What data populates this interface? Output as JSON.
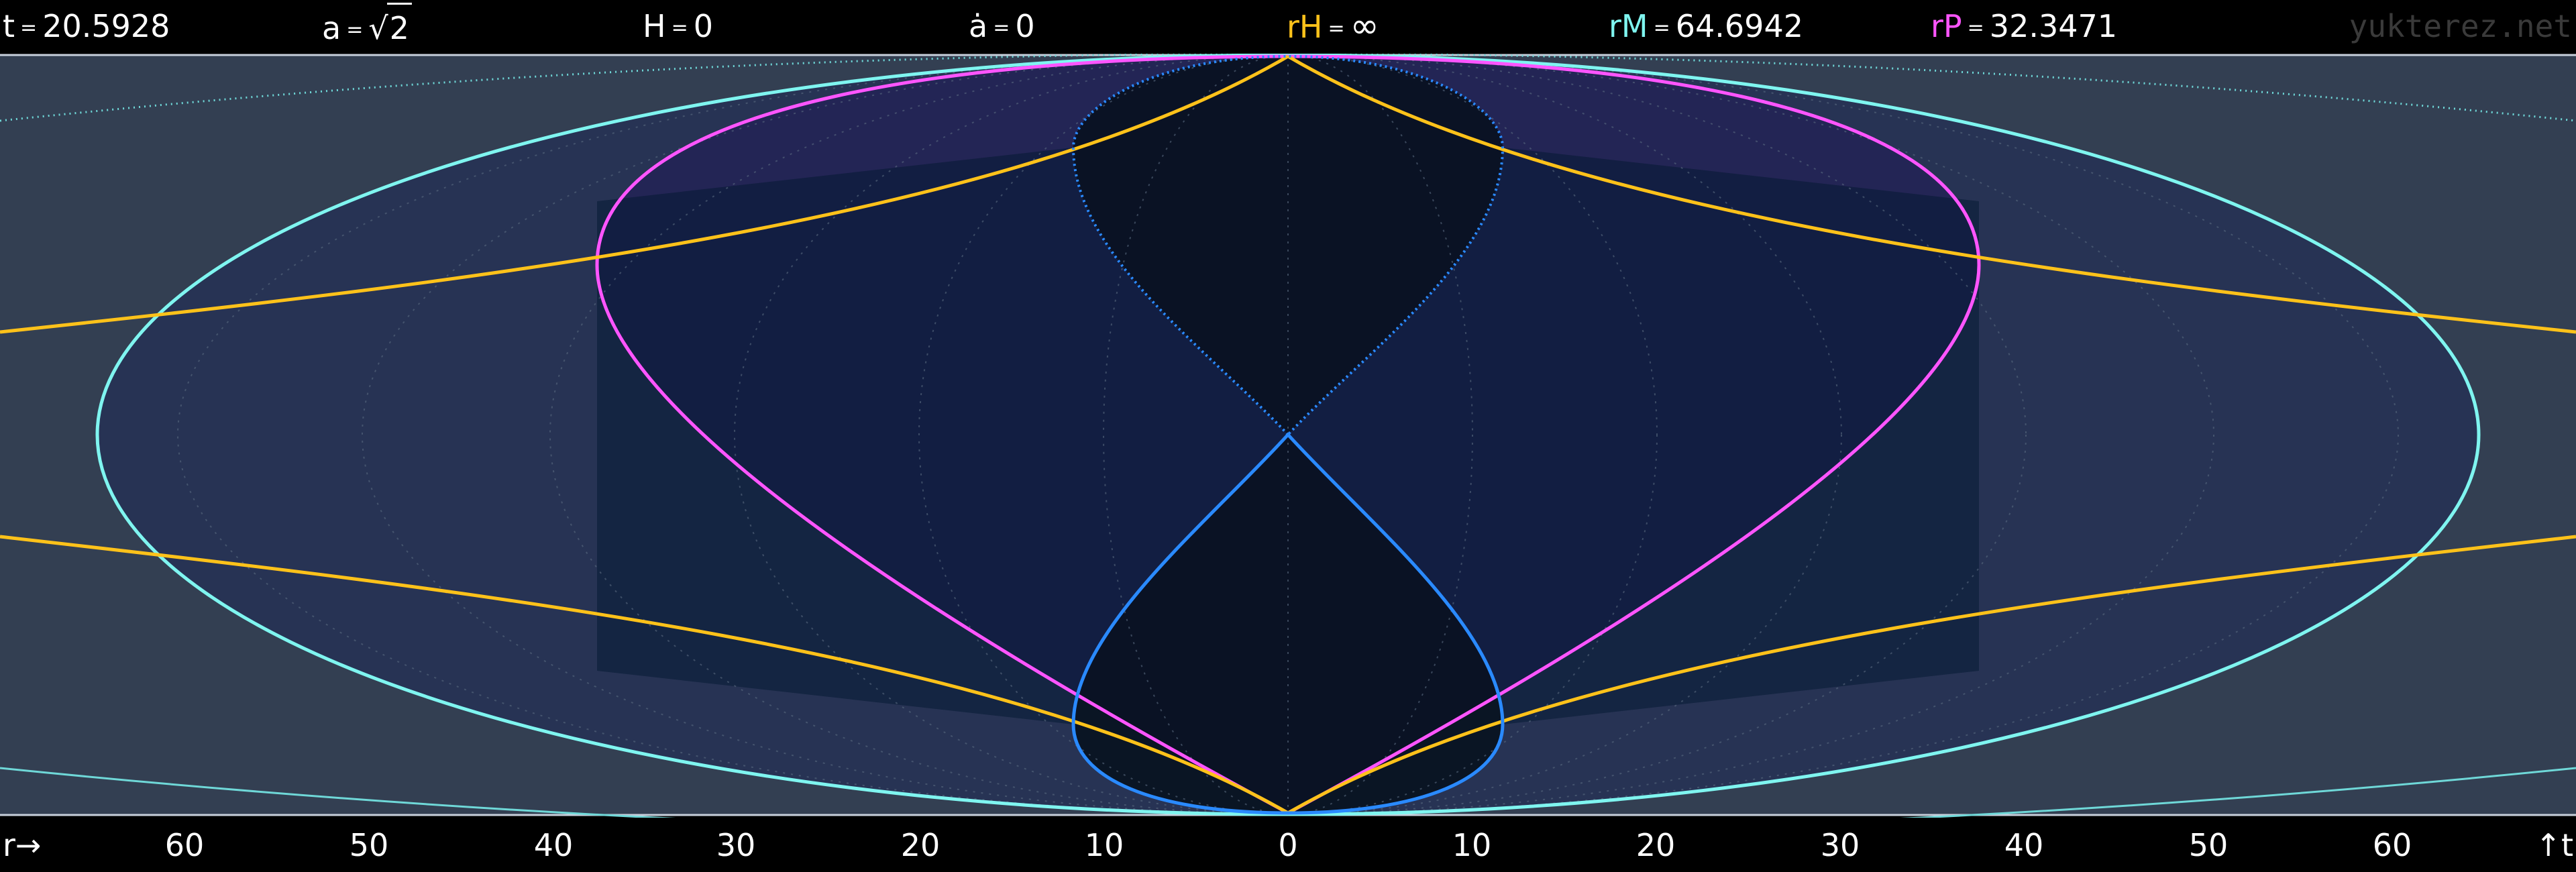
{
  "header": {
    "t": {
      "symbol": "t",
      "eq": "=",
      "value": "20.5928",
      "color": "#ffffff"
    },
    "a": {
      "symbol": "a",
      "eq": "=",
      "radical": "√",
      "radicand": "2",
      "color": "#ffffff"
    },
    "H": {
      "symbol": "H",
      "eq": "=",
      "value": "0",
      "color": "#ffffff"
    },
    "adot": {
      "symbol": "ȧ",
      "eq": "=",
      "value": "0",
      "color": "#ffffff"
    },
    "rH": {
      "symbol": "rH",
      "eq": "=",
      "value": "∞",
      "color": "#ffc21a"
    },
    "rM": {
      "symbol": "rM",
      "eq": "=",
      "value": "64.6942",
      "color": "#7ff5f0"
    },
    "rP": {
      "symbol": "rP",
      "eq": "=",
      "value": "32.3471",
      "color": "#ff55ff"
    },
    "watermark": "yukterez.net"
  },
  "axis": {
    "r_label": "r→",
    "t_label": "↑t",
    "ticks": [
      "60",
      "50",
      "40",
      "30",
      "20",
      "10",
      "0",
      "10",
      "20",
      "30",
      "40",
      "50",
      "60"
    ]
  },
  "colors": {
    "background": "#000000",
    "outer_region": "#333f52",
    "mid_region": "#2a2a4a",
    "inner_region": "#1c1c4c",
    "core_region": "#061a33",
    "center_region": "#040e18",
    "rM_curve": "#7ff5f0",
    "rP_curve": "#ff55ff",
    "rH_curve": "#ffc21a",
    "lightcone_curve": "#2a8aff",
    "grid": "#5a6a80"
  },
  "chart_data": {
    "type": "diagram",
    "x_axis": {
      "label": "r→",
      "range": [
        -70,
        70
      ]
    },
    "y_axis": {
      "label": "↑t"
    },
    "curves": [
      {
        "name": "rM",
        "value": 64.6942
      },
      {
        "name": "rP",
        "value": 32.3471
      },
      {
        "name": "rH",
        "value": "∞"
      }
    ]
  }
}
